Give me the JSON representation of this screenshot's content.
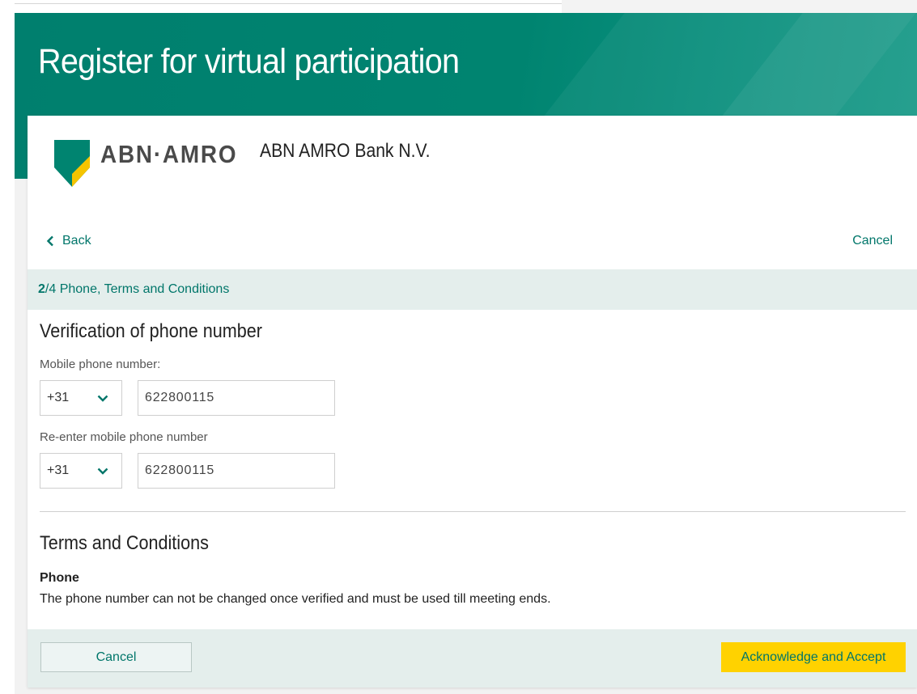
{
  "header": {
    "title": "Register for virtual participation"
  },
  "brand": {
    "logo_text": "ABN·AMRO",
    "company_name": "ABN AMRO Bank N.V.",
    "colors": {
      "teal": "#008470",
      "yellow": "#f5c400"
    }
  },
  "nav": {
    "back_label": "Back",
    "cancel_label": "Cancel"
  },
  "stepper": {
    "current": "2",
    "separator_total": "/4",
    "title": "Phone, Terms and Conditions"
  },
  "verification": {
    "title": "Verification of phone number",
    "mobile_label": "Mobile phone number:",
    "mobile_country_code": "+31",
    "mobile_number": "622800115",
    "reenter_label": "Re-enter mobile phone number",
    "reenter_country_code": "+31",
    "reenter_number": "622800115"
  },
  "terms": {
    "title": "Terms and Conditions",
    "phone_heading": "Phone",
    "phone_text": "The phone number can not be changed once verified and must be used till meeting ends."
  },
  "footer": {
    "cancel_label": "Cancel",
    "accept_label": "Acknowledge and Accept"
  },
  "icons": {
    "back": "chevron-left-icon",
    "dropdown": "chevron-down-icon"
  }
}
